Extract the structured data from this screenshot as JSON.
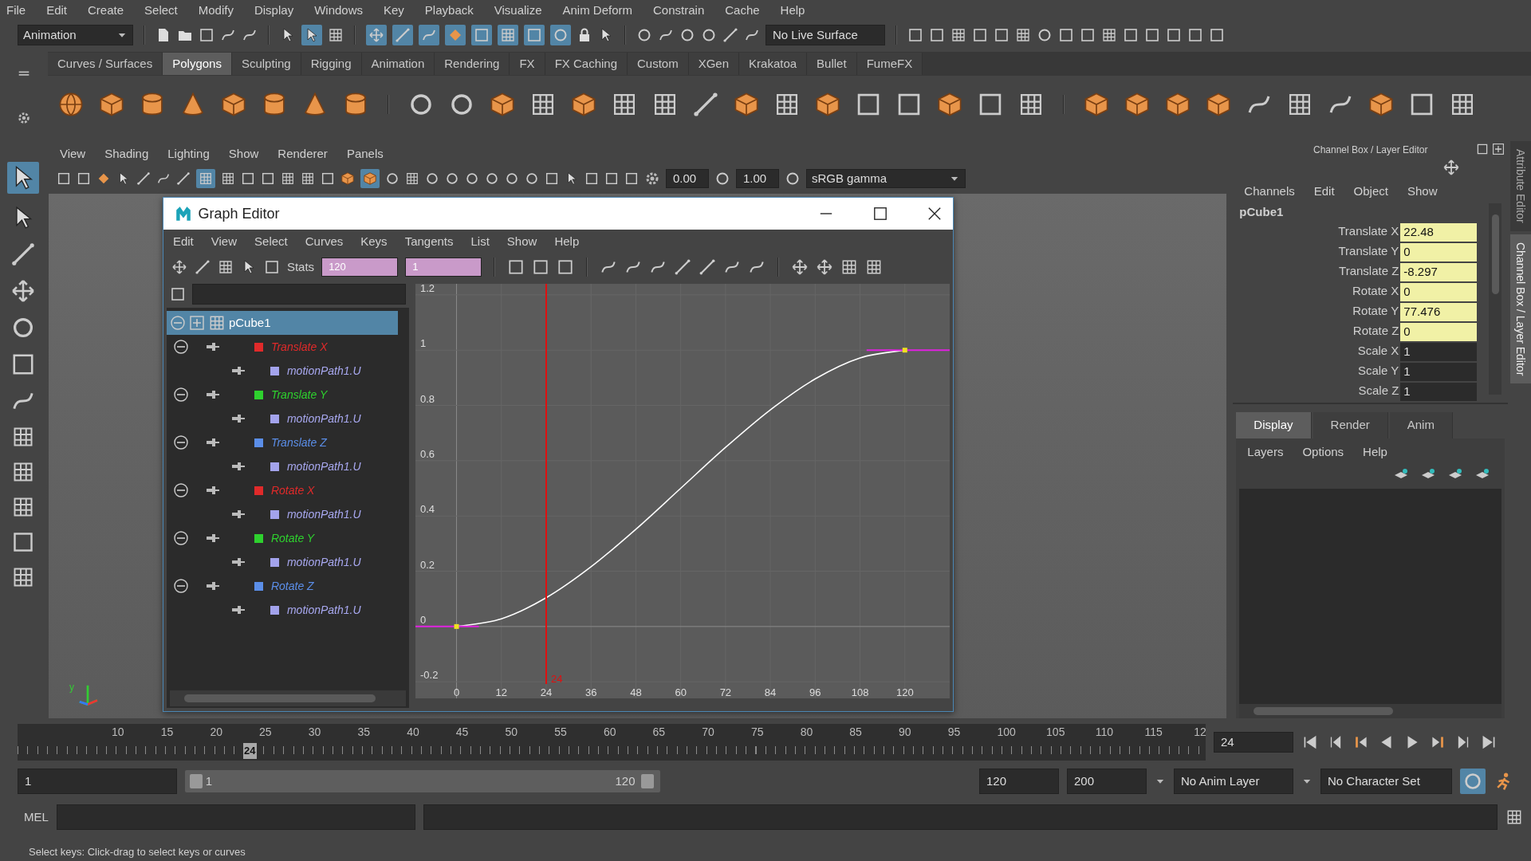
{
  "menu_bar": [
    "File",
    "Edit",
    "Create",
    "Select",
    "Modify",
    "Display",
    "Windows",
    "Key",
    "Playback",
    "Visualize",
    "Anim Deform",
    "Constrain",
    "Cache",
    "Help"
  ],
  "status_line": {
    "menu_set": "Animation",
    "live_surface": "No Live Surface"
  },
  "shelf": {
    "tabs": [
      {
        "label": "Curves / Surfaces",
        "selected": false
      },
      {
        "label": "Polygons",
        "selected": true
      },
      {
        "label": "Sculpting",
        "selected": false
      },
      {
        "label": "Rigging",
        "selected": false
      },
      {
        "label": "Animation",
        "selected": false
      },
      {
        "label": "Rendering",
        "selected": false
      },
      {
        "label": "FX",
        "selected": false
      },
      {
        "label": "FX Caching",
        "selected": false
      },
      {
        "label": "Custom",
        "selected": false
      },
      {
        "label": "XGen",
        "selected": false
      },
      {
        "label": "Krakatoa",
        "selected": false
      },
      {
        "label": "Bullet",
        "selected": false
      },
      {
        "label": "FumeFX",
        "selected": false
      }
    ]
  },
  "viewport": {
    "menus": [
      "View",
      "Shading",
      "Lighting",
      "Show",
      "Renderer",
      "Panels"
    ],
    "exposure": "0.00",
    "gamma": "1.00",
    "color_space": "sRGB gamma",
    "axis_label": "y"
  },
  "graph_editor": {
    "title": "Graph Editor",
    "menus": [
      "Edit",
      "View",
      "Select",
      "Curves",
      "Keys",
      "Tangents",
      "List",
      "Show",
      "Help"
    ],
    "stats_label": "Stats",
    "stats_fields": [
      "120",
      "1"
    ],
    "outliner": {
      "object": {
        "label": "pCube1",
        "selected": true
      },
      "channels": [
        {
          "label": "Translate X",
          "color": "#e02a2a",
          "children": [
            {
              "label": "motionPath1.U"
            }
          ]
        },
        {
          "label": "Translate Y",
          "color": "#2ed12e",
          "children": [
            {
              "label": "motionPath1.U"
            }
          ]
        },
        {
          "label": "Translate Z",
          "color": "#5b8ee8",
          "children": [
            {
              "label": "motionPath1.U"
            }
          ]
        },
        {
          "label": "Rotate X",
          "color": "#e02a2a",
          "children": [
            {
              "label": "motionPath1.U"
            }
          ]
        },
        {
          "label": "Rotate Y",
          "color": "#2ed12e",
          "children": [
            {
              "label": "motionPath1.U"
            }
          ]
        },
        {
          "label": "Rotate Z",
          "color": "#5b8ee8",
          "children": [
            {
              "label": "motionPath1.U"
            }
          ]
        }
      ]
    },
    "chart_data": {
      "type": "line",
      "x": [
        0,
        12,
        24,
        36,
        48,
        60,
        72,
        84,
        96,
        108,
        120
      ],
      "series": [
        {
          "color": "#ffffff",
          "values": [
            0,
            0.028,
            0.104,
            0.216,
            0.352,
            0.5,
            0.648,
            0.784,
            0.896,
            0.972,
            1
          ]
        }
      ],
      "xlim": [
        -11,
        132
      ],
      "ylim": [
        -0.26,
        1.24
      ],
      "xticks": [
        0,
        12,
        24,
        36,
        48,
        60,
        72,
        84,
        96,
        108,
        120
      ],
      "yticks": [
        -0.2,
        0,
        0.2,
        0.4,
        0.6,
        0.8,
        1,
        1.2
      ],
      "grid": true,
      "ref_lines": [
        {
          "axis": "x",
          "value": 24,
          "label": "24",
          "color": "#e01010"
        }
      ]
    }
  },
  "channel_box": {
    "title": "Channel Box / Layer Editor",
    "menus": [
      "Channels",
      "Edit",
      "Object",
      "Show"
    ],
    "object": "pCube1",
    "attributes": [
      {
        "label": "Translate X",
        "value": "22.48",
        "keyed": true
      },
      {
        "label": "Translate Y",
        "value": "0",
        "keyed": true
      },
      {
        "label": "Translate Z",
        "value": "-8.297",
        "keyed": true
      },
      {
        "label": "Rotate X",
        "value": "0",
        "keyed": true
      },
      {
        "label": "Rotate Y",
        "value": "77.476",
        "keyed": true
      },
      {
        "label": "Rotate Z",
        "value": "0",
        "keyed": true
      },
      {
        "label": "Scale X",
        "value": "1",
        "keyed": false
      },
      {
        "label": "Scale Y",
        "value": "1",
        "keyed": false
      },
      {
        "label": "Scale Z",
        "value": "1",
        "keyed": false
      }
    ]
  },
  "layer_editor": {
    "tabs": [
      {
        "label": "Display",
        "selected": true
      },
      {
        "label": "Render",
        "selected": false
      },
      {
        "label": "Anim",
        "selected": false
      }
    ],
    "menus": [
      "Layers",
      "Options",
      "Help"
    ]
  },
  "side_tabs": [
    {
      "label": "Attribute Editor",
      "selected": false
    },
    {
      "label": "Channel Box / Layer Editor",
      "selected": true
    }
  ],
  "time_slider": {
    "frame_labels": [
      "10",
      "15",
      "20",
      "25",
      "30",
      "35",
      "40",
      "45",
      "50",
      "55",
      "60",
      "65",
      "70",
      "75",
      "80",
      "85",
      "90",
      "95",
      "100",
      "105",
      "110",
      "115",
      "12"
    ],
    "current_frame": "24",
    "level": 0.19,
    "current_time": "24"
  },
  "range_slider": {
    "start_time": "1",
    "playback_start": "1",
    "playback_end": "120",
    "playback_end_field": "120",
    "end_time": "200",
    "anim_layer": "No Anim Layer",
    "character_set": "No Character Set"
  },
  "command_line": {
    "label": "MEL"
  },
  "help_line": "Select keys: Click-drag to select keys or curves"
}
